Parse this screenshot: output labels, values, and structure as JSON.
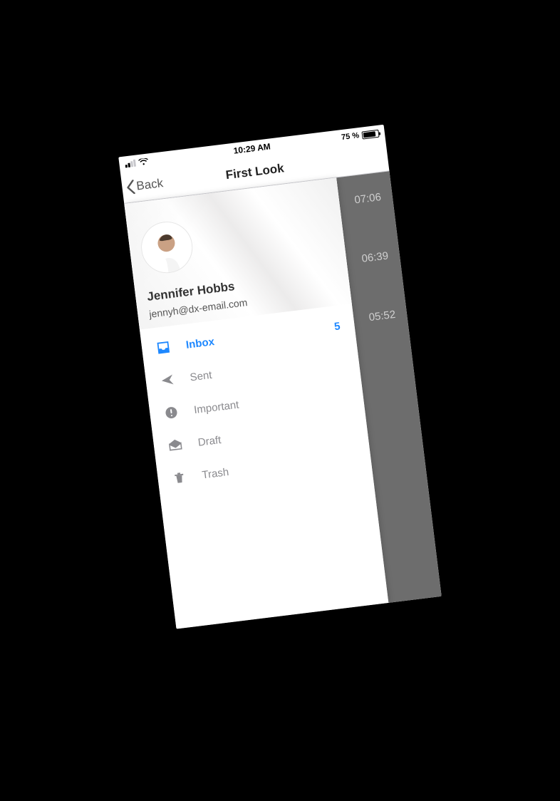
{
  "status": {
    "time": "10:29 AM",
    "battery_pct": "75 %"
  },
  "nav": {
    "back_label": "Back",
    "title": "First Look"
  },
  "profile": {
    "name": "Jennifer Hobbs",
    "email": "jennyh@dx-email.com"
  },
  "folders": [
    {
      "icon": "inbox",
      "label": "Inbox",
      "count": "5",
      "active": true
    },
    {
      "icon": "sent",
      "label": "Sent",
      "count": "",
      "active": false
    },
    {
      "icon": "important",
      "label": "Important",
      "count": "",
      "active": false
    },
    {
      "icon": "draft",
      "label": "Draft",
      "count": "",
      "active": false
    },
    {
      "icon": "trash",
      "label": "Trash",
      "count": "",
      "active": false
    }
  ],
  "behind_times": [
    "07:06",
    "06:39",
    "05:52"
  ],
  "colors": {
    "accent": "#1e88ff",
    "muted": "#8a8a8e",
    "overlay": "#6d6d6d"
  }
}
